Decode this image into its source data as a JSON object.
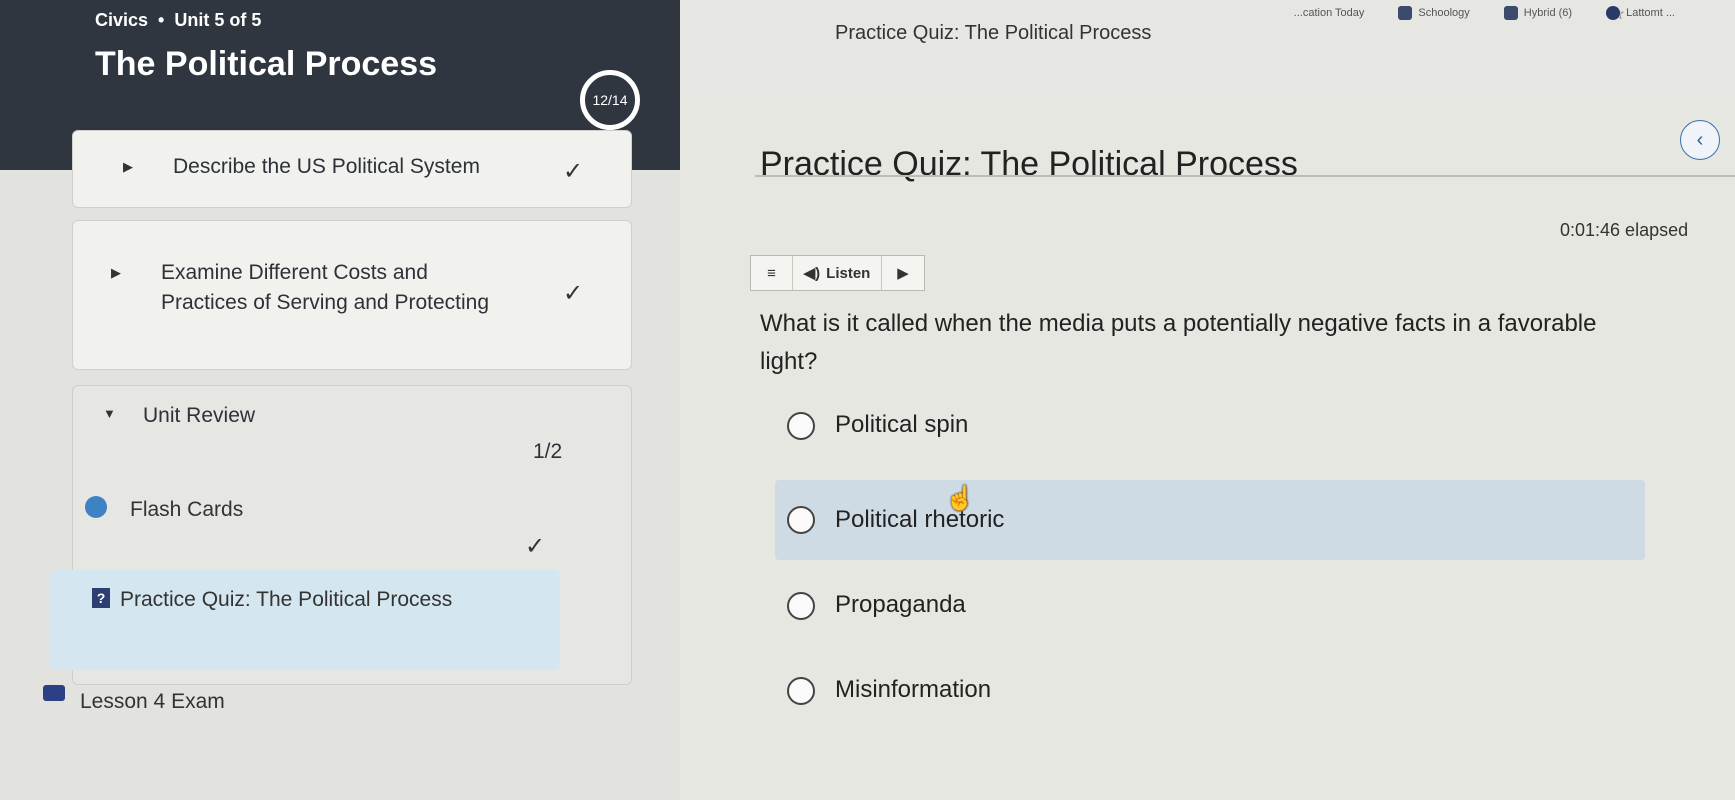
{
  "browser": {
    "tab_title": "Practice Quiz: The Political Process",
    "bookmarks": [
      "...cation Today",
      "Schoology",
      "Hybrid (6)",
      "Lattomt ..."
    ]
  },
  "sidebar": {
    "breadcrumb_course": "Civics",
    "breadcrumb_separator": "•",
    "breadcrumb_unit": "Unit 5 of 5",
    "unit_title": "The Political Process",
    "progress": "12/14",
    "lessons": [
      {
        "label": "Describe the US Political System",
        "completed": true
      },
      {
        "label_line1": "Examine Different Costs and",
        "label_line2": "Practices of Serving and Protecting",
        "completed": true
      },
      {
        "label": "Unit Review",
        "progress": "1/2",
        "expanded": true
      }
    ],
    "review_items": [
      {
        "label": "Flash Cards",
        "icon": "flash-cards-icon",
        "completed": true
      },
      {
        "label": "Practice Quiz: The Political Process",
        "icon": "quiz-icon",
        "active": true
      }
    ],
    "exam": {
      "label": "Lesson 4 Exam",
      "icon": "exam-icon"
    }
  },
  "main": {
    "quiz_title": "Practice Quiz: The Political Process",
    "elapsed": "0:01:46 elapsed",
    "listen_label": "Listen",
    "question": "What is it called when the media puts a potentially negative facts in a favorable light?",
    "options": [
      "Political spin",
      "Political rhetoric",
      "Propaganda",
      "Misinformation"
    ],
    "hovered_option": 1
  }
}
